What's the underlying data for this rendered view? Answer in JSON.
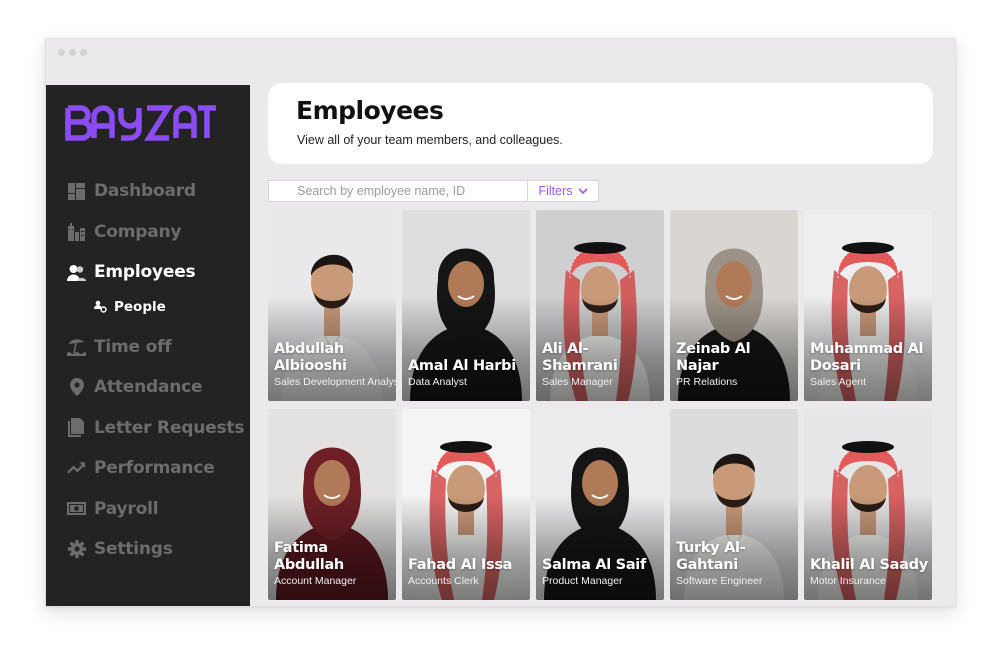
{
  "app": {
    "brand": "BAYZAT",
    "brand_color": "#8b4cf3"
  },
  "sidebar": {
    "items": [
      {
        "label": "Dashboard",
        "icon": "dashboard-icon",
        "active": false
      },
      {
        "label": "Company",
        "icon": "company-building-icon",
        "active": false
      },
      {
        "label": "Employees",
        "icon": "employees-icon",
        "active": true
      },
      {
        "label": "Time off",
        "icon": "beach-umbrella-icon",
        "active": false
      },
      {
        "label": "Attendance",
        "icon": "location-pin-icon",
        "active": false
      },
      {
        "label": "Letter Requests",
        "icon": "document-icon",
        "active": false
      },
      {
        "label": "Performance",
        "icon": "trending-up-icon",
        "active": false
      },
      {
        "label": "Payroll",
        "icon": "banknote-icon",
        "active": false
      },
      {
        "label": "Settings",
        "icon": "gear-icon",
        "active": false
      }
    ],
    "sub_items": [
      {
        "label": "People",
        "icon": "people-icon",
        "parent": "Employees"
      }
    ]
  },
  "header": {
    "title": "Employees",
    "subtitle": "View all of your team members, and colleagues."
  },
  "toolbar": {
    "search_placeholder": "Search by employee name, ID",
    "search_value": "",
    "filters_label": "Filters",
    "accent_color": "#9b59f0"
  },
  "employees": [
    {
      "name": "Abdullah Albiooshi",
      "role": "Sales Development Analyst",
      "tone": "light",
      "attire": "thobe",
      "bg": "#e9e9ec"
    },
    {
      "name": "Amal Al Harbi",
      "role": "Data Analyst",
      "tone": "dark",
      "attire": "hijab-black",
      "bg": "#dedde0"
    },
    {
      "name": "Ali Al-Shamrani",
      "role": "Sales Manager",
      "tone": "light",
      "attire": "shemagh",
      "bg": "#cfcfd1"
    },
    {
      "name": "Zeinab Al Najar",
      "role": "PR Relations",
      "tone": "dark",
      "attire": "hijab-beige",
      "bg": "#d9d6d2"
    },
    {
      "name": "Muhammad Al Dosari",
      "role": "Sales Agent",
      "tone": "light",
      "attire": "shemagh",
      "bg": "#eeeef0"
    },
    {
      "name": "Fatima Abdullah",
      "role": "Account Manager",
      "tone": "dark",
      "attire": "hijab-maroon",
      "bg": "#e4e1e1"
    },
    {
      "name": "Fahad Al Issa",
      "role": "Accounts Clerk",
      "tone": "light",
      "attire": "shemagh",
      "bg": "#f4f4f5"
    },
    {
      "name": "Salma Al Saif",
      "role": "Product Manager",
      "tone": "dark",
      "attire": "hijab-black",
      "bg": "#ececee"
    },
    {
      "name": "Turky Al-Gahtani",
      "role": "Software Engineer",
      "tone": "light",
      "attire": "thobe",
      "bg": "#dcdcde"
    },
    {
      "name": "Khalil Al Saady",
      "role": "Motor Insurance",
      "tone": "light",
      "attire": "shemagh",
      "bg": "#e6e6e8"
    }
  ]
}
